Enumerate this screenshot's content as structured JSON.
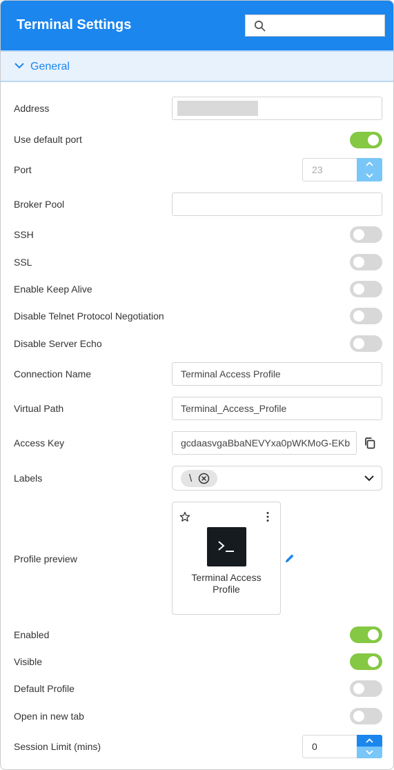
{
  "header": {
    "title": "Terminal Settings",
    "search_placeholder": "",
    "search_icon": "search-icon"
  },
  "section": {
    "title": "General",
    "expanded": true
  },
  "fields": {
    "address": {
      "label": "Address",
      "value": ""
    },
    "use_default_port": {
      "label": "Use default port",
      "on": true
    },
    "port": {
      "label": "Port",
      "value": "23"
    },
    "broker_pool": {
      "label": "Broker Pool",
      "value": ""
    },
    "ssh": {
      "label": "SSH",
      "on": false
    },
    "ssl": {
      "label": "SSL",
      "on": false
    },
    "keep_alive": {
      "label": "Enable Keep Alive",
      "on": false
    },
    "disable_telnet": {
      "label": "Disable Telnet Protocol Negotiation",
      "on": false
    },
    "disable_echo": {
      "label": "Disable Server Echo",
      "on": false
    },
    "connection_name": {
      "label": "Connection Name",
      "value": "Terminal Access Profile"
    },
    "virtual_path": {
      "label": "Virtual Path",
      "value": "Terminal_Access_Profile"
    },
    "access_key": {
      "label": "Access Key",
      "value": "gcdaasvgaBbaNEVYxa0pWKMoG-EKb"
    },
    "labels": {
      "label": "Labels",
      "chips": [
        "\\"
      ]
    },
    "profile_preview": {
      "label": "Profile preview",
      "card_title_line1": "Terminal Access",
      "card_title_line2": "Profile",
      "tile_icon": "terminal-prompt-icon"
    },
    "enabled": {
      "label": "Enabled",
      "on": true
    },
    "visible": {
      "label": "Visible",
      "on": true
    },
    "default_profile": {
      "label": "Default Profile",
      "on": false
    },
    "open_new_tab": {
      "label": "Open in new tab",
      "on": false
    },
    "session_limit": {
      "label": "Session Limit (mins)",
      "value": "0"
    }
  },
  "colors": {
    "header": "#1b86ee",
    "accent": "#1b86ee",
    "toggle_on": "#84c843",
    "toggle_off": "#d8d8d8",
    "section_bg": "#e8f2fd"
  }
}
